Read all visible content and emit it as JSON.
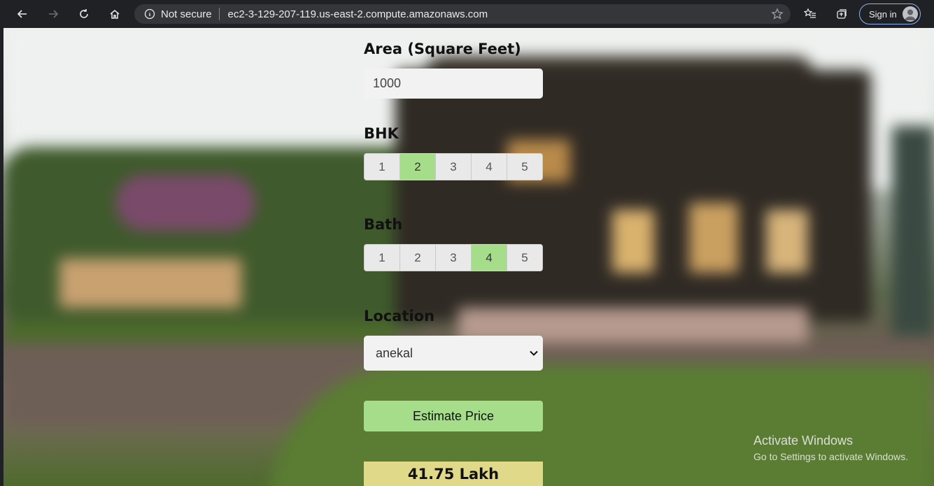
{
  "browser": {
    "security_label": "Not secure",
    "url": "ec2-3-129-207-119.us-east-2.compute.amazonaws.com",
    "signin_label": "Sign in"
  },
  "form": {
    "area_label": "Area (Square Feet)",
    "area_value": "1000",
    "bhk_label": "BHK",
    "bhk_options": [
      "1",
      "2",
      "3",
      "4",
      "5"
    ],
    "bhk_selected": "2",
    "bath_label": "Bath",
    "bath_options": [
      "1",
      "2",
      "3",
      "4",
      "5"
    ],
    "bath_selected": "4",
    "location_label": "Location",
    "location_selected": "anekal",
    "estimate_button": "Estimate Price",
    "result": "41.75 Lakh"
  },
  "watermark": {
    "title": "Activate Windows",
    "subtitle": "Go to Settings to activate Windows."
  },
  "colors": {
    "selected": "#a6dd8b",
    "result_bg": "#e0d98a"
  }
}
